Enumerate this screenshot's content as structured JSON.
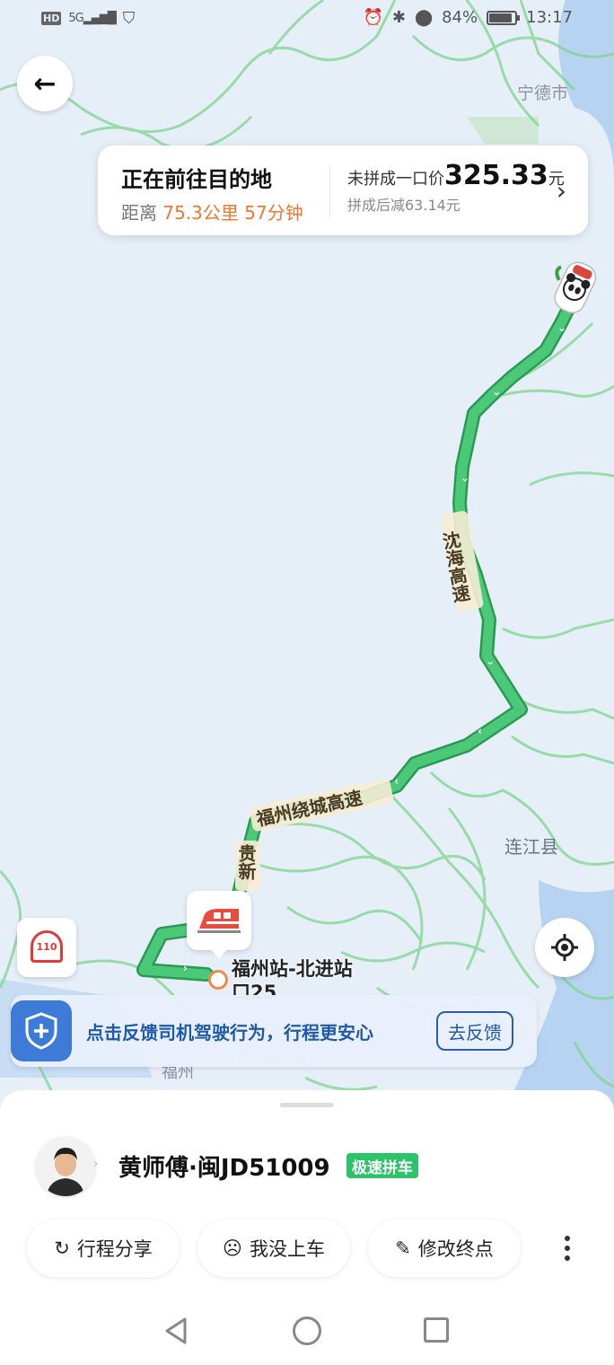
{
  "status_bar": {
    "hd": "HD",
    "signal": "5G",
    "battery_text": "84%",
    "battery_level": 0.84,
    "time": "13:17"
  },
  "map": {
    "labels": {
      "ningde": "宁德市",
      "lianjiang": "连江县",
      "fuzhou_partial": "福州"
    },
    "roads": {
      "shenhai": "沈海高速",
      "fuzhou_ring": "福州绕城高速",
      "guixin": "贵新"
    },
    "station": {
      "line1": "福州站-北进站",
      "line2": "口25"
    },
    "sos_label": "110"
  },
  "trip_card": {
    "title": "正在前往目的地",
    "distance_prefix": "距离",
    "distance": "75.3公里",
    "eta": "57分钟",
    "price_prefix": "未拼成一口价",
    "price": "325.33",
    "price_unit": "元",
    "discount": "拼成后减63.14元"
  },
  "feedback": {
    "text": "点击反馈司机驾驶行为，行程更安心",
    "button": "去反馈"
  },
  "driver": {
    "name": "黄师傅·闽JD51009",
    "badge": "极速拼车"
  },
  "actions": {
    "share": "行程分享",
    "not_boarded": "我没上车",
    "change_dest": "修改终点"
  },
  "colors": {
    "route": "#3db86a",
    "accent_orange": "#f2762e",
    "brand_blue": "#1e5aa8",
    "badge_green": "#2ec26a"
  }
}
